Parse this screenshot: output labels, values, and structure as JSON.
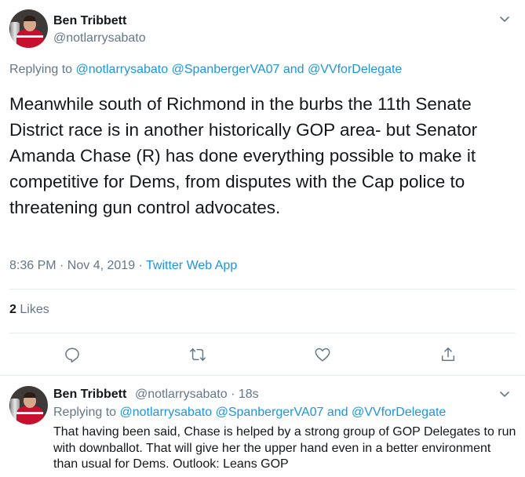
{
  "main_tweet": {
    "author_name": "Ben Tribbett",
    "author_handle": "@notlarrysabato",
    "replying_prefix": "Replying to",
    "replying_to_1": "@notlarrysabato",
    "replying_to_2": "@SpanbergerVA07",
    "replying_and": "and",
    "replying_to_3": "@VVforDelegate",
    "text": "Meanwhile south of Richmond in the burbs the 11th Senate District race is in another historically GOP area- but Senator Amanda Chase (R) has done everything possible to make it competitive for Dems, from disputes with the Cap police to threatening gun control advocates.",
    "timestamp": "8:36 PM · Nov 4, 2019 ·",
    "source": "Twitter Web App",
    "likes_count": "2",
    "likes_label": "Likes"
  },
  "reply_tweet": {
    "author_name": "Ben Tribbett",
    "author_handle": "@notlarrysabato",
    "time_ago": "· 18s",
    "replying_prefix": "Replying to",
    "replying_to_1": "@notlarrysabato",
    "replying_to_2": "@SpanbergerVA07",
    "replying_and": "and",
    "replying_to_3": "@VVforDelegate",
    "text": "That having been said, Chase is helped by a strong group of GOP Delegates to run with downballot.  That will give her the upper hand even in a better environment than usual for Dems.  Outlook:  Leans GOP"
  },
  "icons": [
    "chevron-down-icon",
    "reply-icon",
    "retweet-icon",
    "like-icon",
    "share-icon"
  ],
  "colors": {
    "link": "#1b95e0",
    "secondary_text": "#657786",
    "primary_text": "#14171a",
    "divider": "#e6ecf0"
  }
}
